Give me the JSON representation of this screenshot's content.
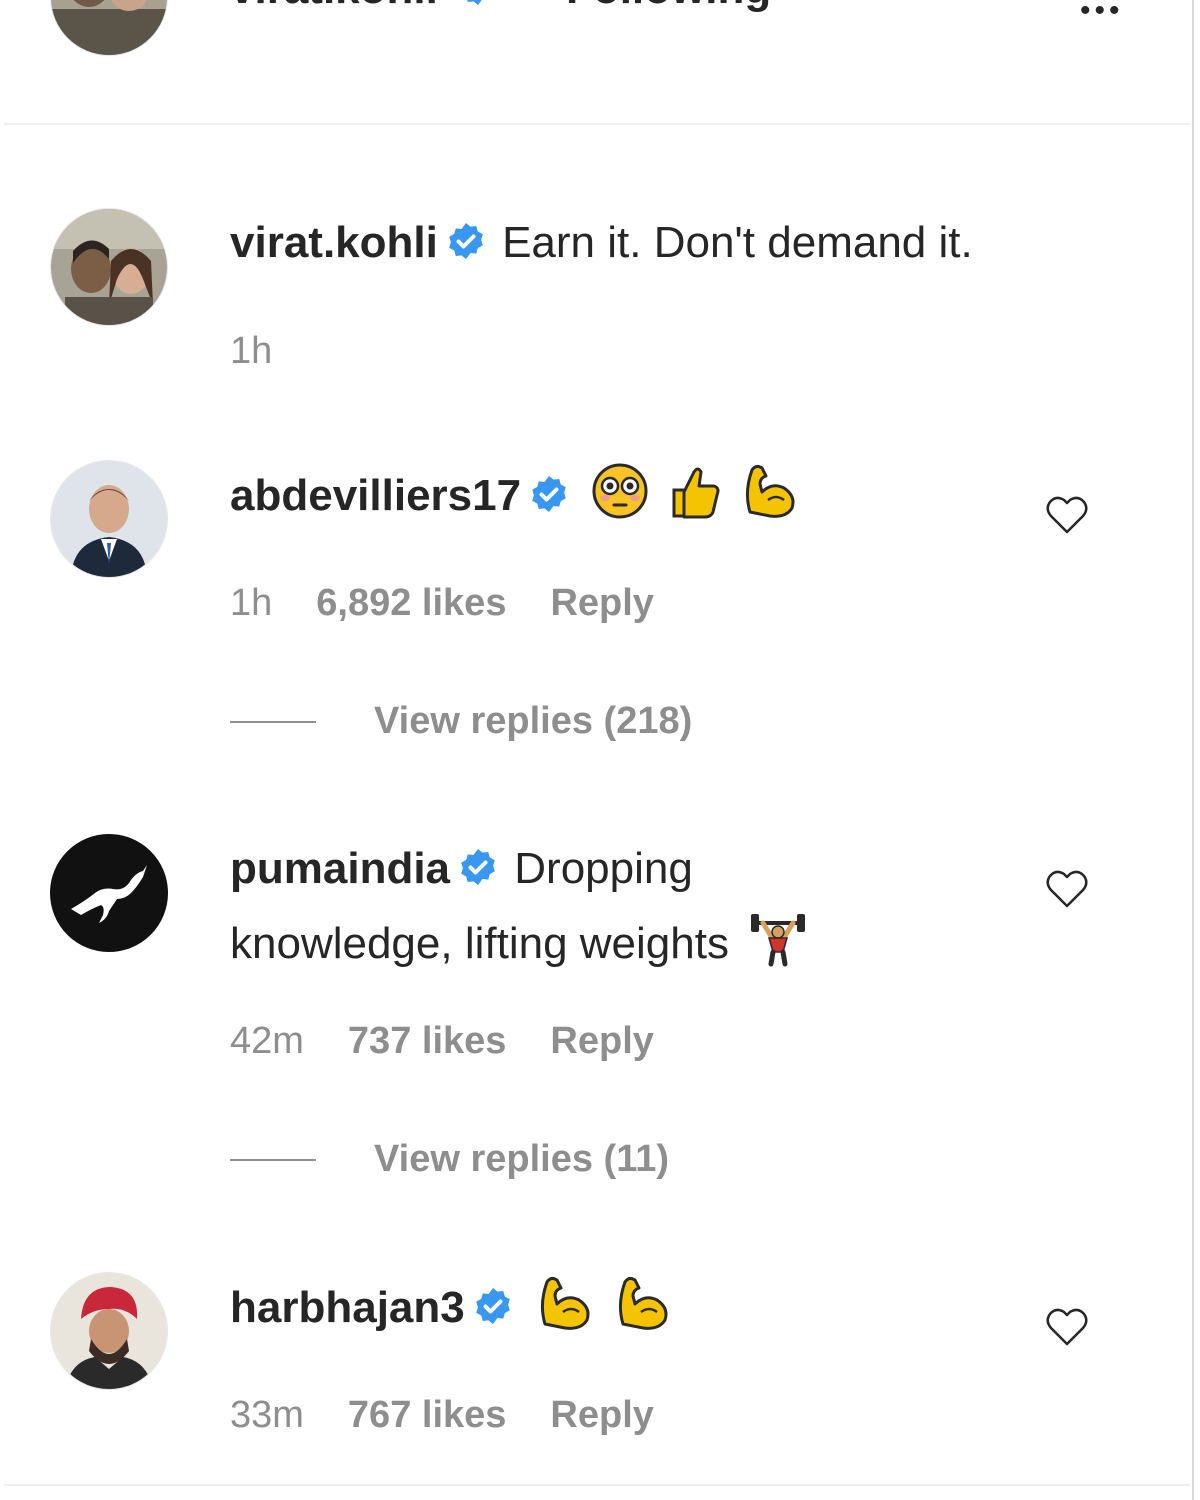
{
  "header": {
    "username": "virat.kohli",
    "separator": "•",
    "follow_status": "Following"
  },
  "caption": {
    "username": "virat.kohli",
    "text": "Earn it. Don't demand it.",
    "time": "1h"
  },
  "comments": [
    {
      "username": "abdevilliers17",
      "emojis": [
        "flushed-face-icon",
        "thumbs-up-icon",
        "flexed-biceps-icon"
      ],
      "time": "1h",
      "likes": "6,892 likes",
      "reply_label": "Reply",
      "view_replies": "View replies (218)"
    },
    {
      "username": "pumaindia",
      "text_line1": "Dropping",
      "text_line2": "knowledge, lifting weights",
      "emojis": [
        "weight-lifter-icon"
      ],
      "time": "42m",
      "likes": "737 likes",
      "reply_label": "Reply",
      "view_replies": "View replies (11)"
    },
    {
      "username": "harbhajan3",
      "emojis": [
        "flexed-biceps-icon",
        "flexed-biceps-icon"
      ],
      "time": "33m",
      "likes": "767 likes",
      "reply_label": "Reply"
    }
  ],
  "colors": {
    "verified_blue": "#3897f0",
    "meta_gray": "#8e8e8e",
    "text": "#262626",
    "emoji_yellow": "#f5c400"
  }
}
